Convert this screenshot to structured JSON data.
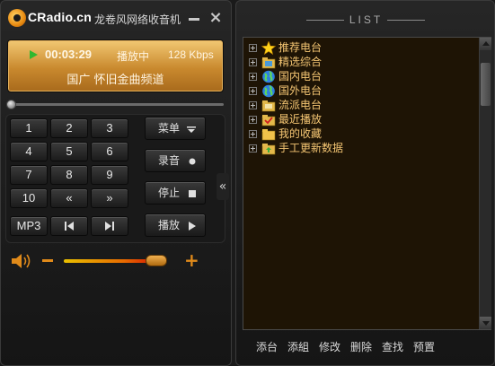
{
  "app": {
    "logo_text": "CRadio.cn",
    "subtitle": "龙卷风网络收音机"
  },
  "display": {
    "time": "00:03:29",
    "status": "播放中",
    "bitrate": "128 Kbps",
    "station": "国广  怀旧金曲频道"
  },
  "keypad": {
    "keys": [
      "1",
      "2",
      "3",
      "4",
      "5",
      "6",
      "7",
      "8",
      "9",
      "10",
      "«",
      "»"
    ],
    "mp3": "MP3",
    "prev_icon": "prev-track-icon",
    "next_icon": "next-track-icon"
  },
  "functions": {
    "menu": "菜单",
    "record": "录音",
    "stop": "停止",
    "play": "播放"
  },
  "volume": {
    "level": 0.92,
    "minus_icon": "volume-down-icon",
    "plus_icon": "volume-up-icon",
    "speaker_icon": "speaker-icon"
  },
  "list": {
    "title": "LIST",
    "items": [
      {
        "label": "推荐电台",
        "icon": "star-icon"
      },
      {
        "label": "精选综合",
        "icon": "folder-radio-icon"
      },
      {
        "label": "国内电台",
        "icon": "globe-icon"
      },
      {
        "label": "国外电台",
        "icon": "globe-icon"
      },
      {
        "label": "流派电台",
        "icon": "folder-genre-icon"
      },
      {
        "label": "最近播放",
        "icon": "folder-recent-icon"
      },
      {
        "label": "我的收藏",
        "icon": "folder-favorite-icon"
      },
      {
        "label": "手工更新数据",
        "icon": "folder-update-icon"
      }
    ]
  },
  "actions": [
    "添台",
    "添組",
    "修改",
    "删除",
    "查找",
    "预置"
  ],
  "colors": {
    "display_bg": "#d9a049",
    "list_text": "#f5c673",
    "accent": "#e08a1a"
  }
}
